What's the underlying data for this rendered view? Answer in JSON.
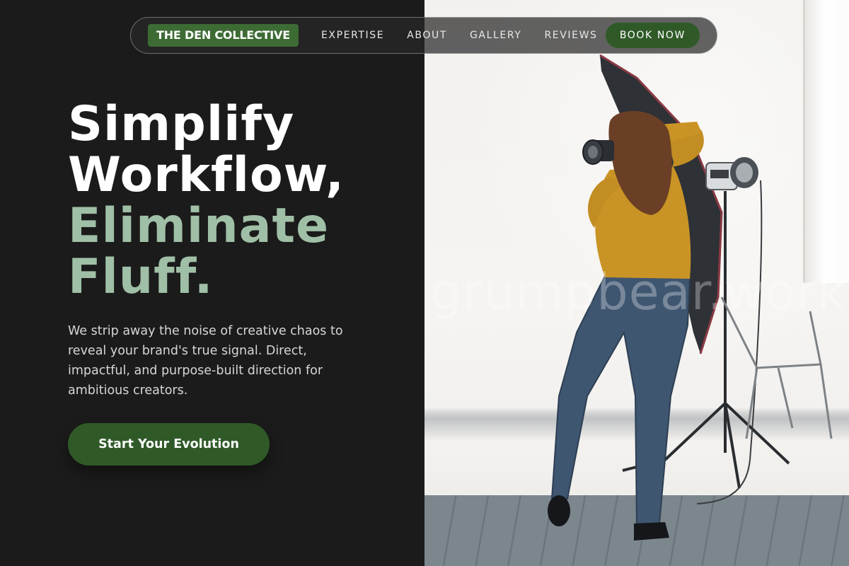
{
  "nav": {
    "brand": "THE DEN COLLECTIVE",
    "links": [
      {
        "label": "EXPERTISE"
      },
      {
        "label": "ABOUT"
      },
      {
        "label": "GALLERY"
      },
      {
        "label": "REVIEWS"
      }
    ],
    "cta_label": "BOOK NOW"
  },
  "hero": {
    "title_line1": "Simplify",
    "title_line2": "Workflow,",
    "title_accent1": "Eliminate",
    "title_accent2": "Fluff.",
    "description": "We strip away the noise of creative chaos to reveal your brand's true signal. Direct, impactful, and purpose-built direction for ambitious creators.",
    "cta_label": "Start Your Evolution"
  },
  "image": {
    "watermark": "grumpbear.work"
  },
  "colors": {
    "background": "#1b1b1b",
    "accent_green": "#2f5a28",
    "brand_green": "#3d6b34",
    "title_accent": "#9fbfa6"
  }
}
